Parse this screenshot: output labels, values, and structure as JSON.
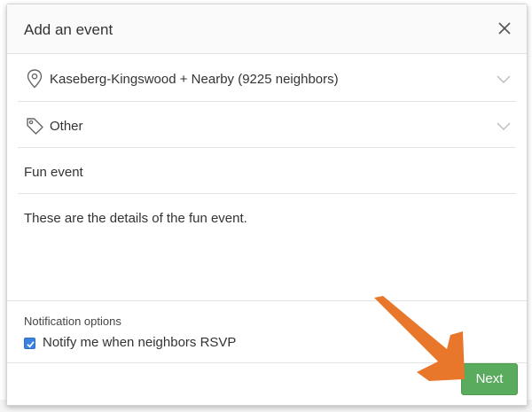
{
  "modal": {
    "title": "Add an event",
    "location": "Kaseberg-Kingswood + Nearby (9225 neighbors)",
    "category": "Other",
    "event_title": "Fun event",
    "details": "These are the details of the fun event.",
    "notifications": {
      "heading": "Notification options",
      "checkbox_label": "Notify me when neighbors RSVP",
      "checked": true
    },
    "next_label": "Next"
  },
  "colors": {
    "accent_green": "#5aab5d",
    "checkbox_blue": "#3b82e0",
    "annotation_arrow": "#e8762b"
  },
  "icons": {
    "close": "close-icon",
    "location": "map-pin-icon",
    "category": "tag-icon",
    "chevron": "chevron-down-icon",
    "annotation": "arrow-icon"
  }
}
